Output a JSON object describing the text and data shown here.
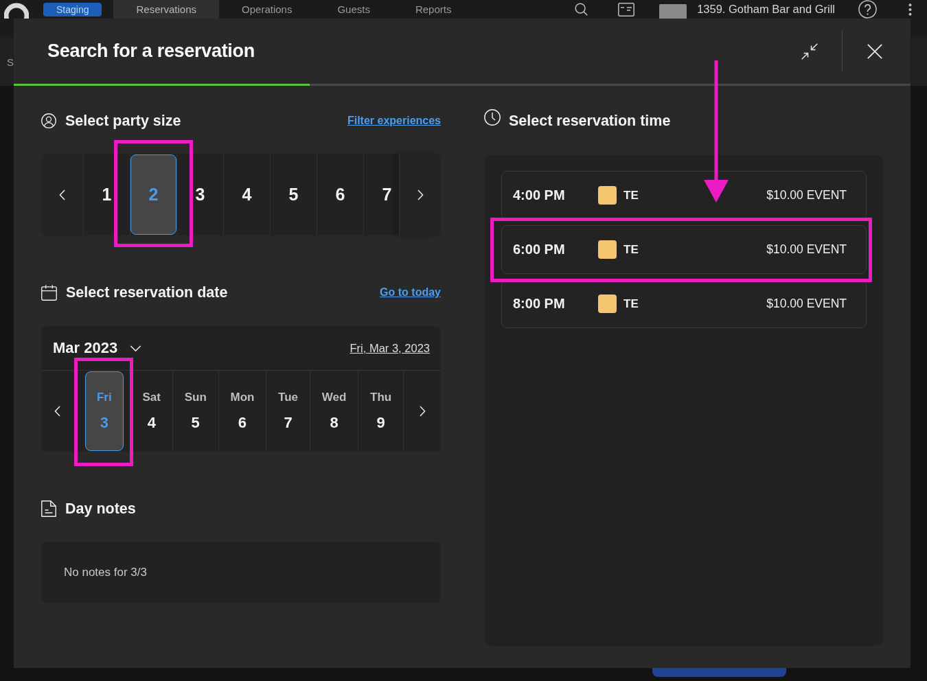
{
  "top_bar": {
    "badge": "Staging",
    "nav": [
      {
        "label": "Reservations",
        "selected": true
      },
      {
        "label": "Operations",
        "selected": false
      },
      {
        "label": "Guests",
        "selected": false
      },
      {
        "label": "Reports",
        "selected": false
      }
    ],
    "venue": "1359. Gotham Bar and Grill"
  },
  "sub_bar": {
    "text": "S"
  },
  "dialog": {
    "title": "Search for a reservation",
    "progress": {
      "level": 0.33
    },
    "party_size": {
      "heading": "Select party size",
      "link": "Filter experiences",
      "options": [
        {
          "label": "1",
          "selected": false,
          "highlighted": false
        },
        {
          "label": "2",
          "selected": true,
          "highlighted": true
        },
        {
          "label": "3",
          "selected": false,
          "highlighted": false
        },
        {
          "label": "4",
          "selected": false,
          "highlighted": false
        },
        {
          "label": "5",
          "selected": false,
          "highlighted": false
        },
        {
          "label": "6",
          "selected": false,
          "highlighted": false
        },
        {
          "label": "7",
          "selected": false,
          "highlighted": false
        }
      ]
    },
    "date": {
      "heading": "Select reservation date",
      "link": "Go to today",
      "month": "Mar 2023",
      "selected_date": "Fri, Mar 3, 2023",
      "days": [
        {
          "weekday": "Fri",
          "day": "3",
          "selected": true,
          "highlighted": true
        },
        {
          "weekday": "Sat",
          "day": "4",
          "selected": false,
          "highlighted": false
        },
        {
          "weekday": "Sun",
          "day": "5",
          "selected": false,
          "highlighted": false
        },
        {
          "weekday": "Mon",
          "day": "6",
          "selected": false,
          "highlighted": false
        },
        {
          "weekday": "Tue",
          "day": "7",
          "selected": false,
          "highlighted": false
        },
        {
          "weekday": "Wed",
          "day": "8",
          "selected": false,
          "highlighted": false
        },
        {
          "weekday": "Thu",
          "day": "9",
          "selected": false,
          "highlighted": false
        }
      ]
    },
    "day_notes": {
      "heading": "Day notes",
      "text": "No notes for 3/3"
    },
    "time": {
      "heading": "Select reservation time",
      "pointer_arrow": true,
      "slots": [
        {
          "time": "4:00 PM",
          "tag": "TE",
          "color": "#f4c56c",
          "price": "$10.00 EVENT",
          "highlighted": false
        },
        {
          "time": "6:00 PM",
          "tag": "TE",
          "color": "#f4c56c",
          "price": "$10.00 EVENT",
          "highlighted": true
        },
        {
          "time": "8:00 PM",
          "tag": "TE",
          "color": "#f4c56c",
          "price": "$10.00 EVENT",
          "highlighted": false
        }
      ]
    }
  }
}
